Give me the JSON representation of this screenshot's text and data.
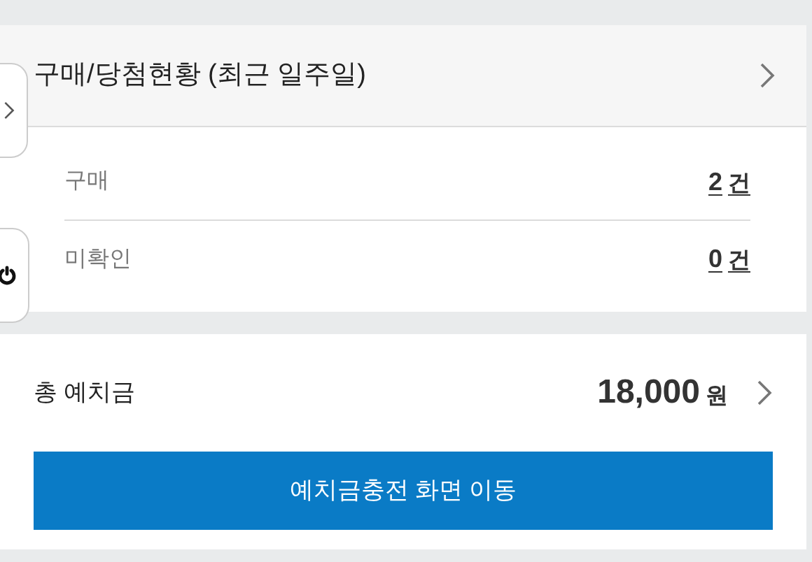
{
  "summary": {
    "title": "구매/당첨현황 (최근 일주일)",
    "rows": [
      {
        "label": "구매",
        "count": "2",
        "unit": "건"
      },
      {
        "label": "미확인",
        "count": "0",
        "unit": "건"
      }
    ]
  },
  "deposit": {
    "label": "총 예치금",
    "amount": "18,000",
    "unit": "원",
    "button": "예치금충전 화면 이동"
  }
}
